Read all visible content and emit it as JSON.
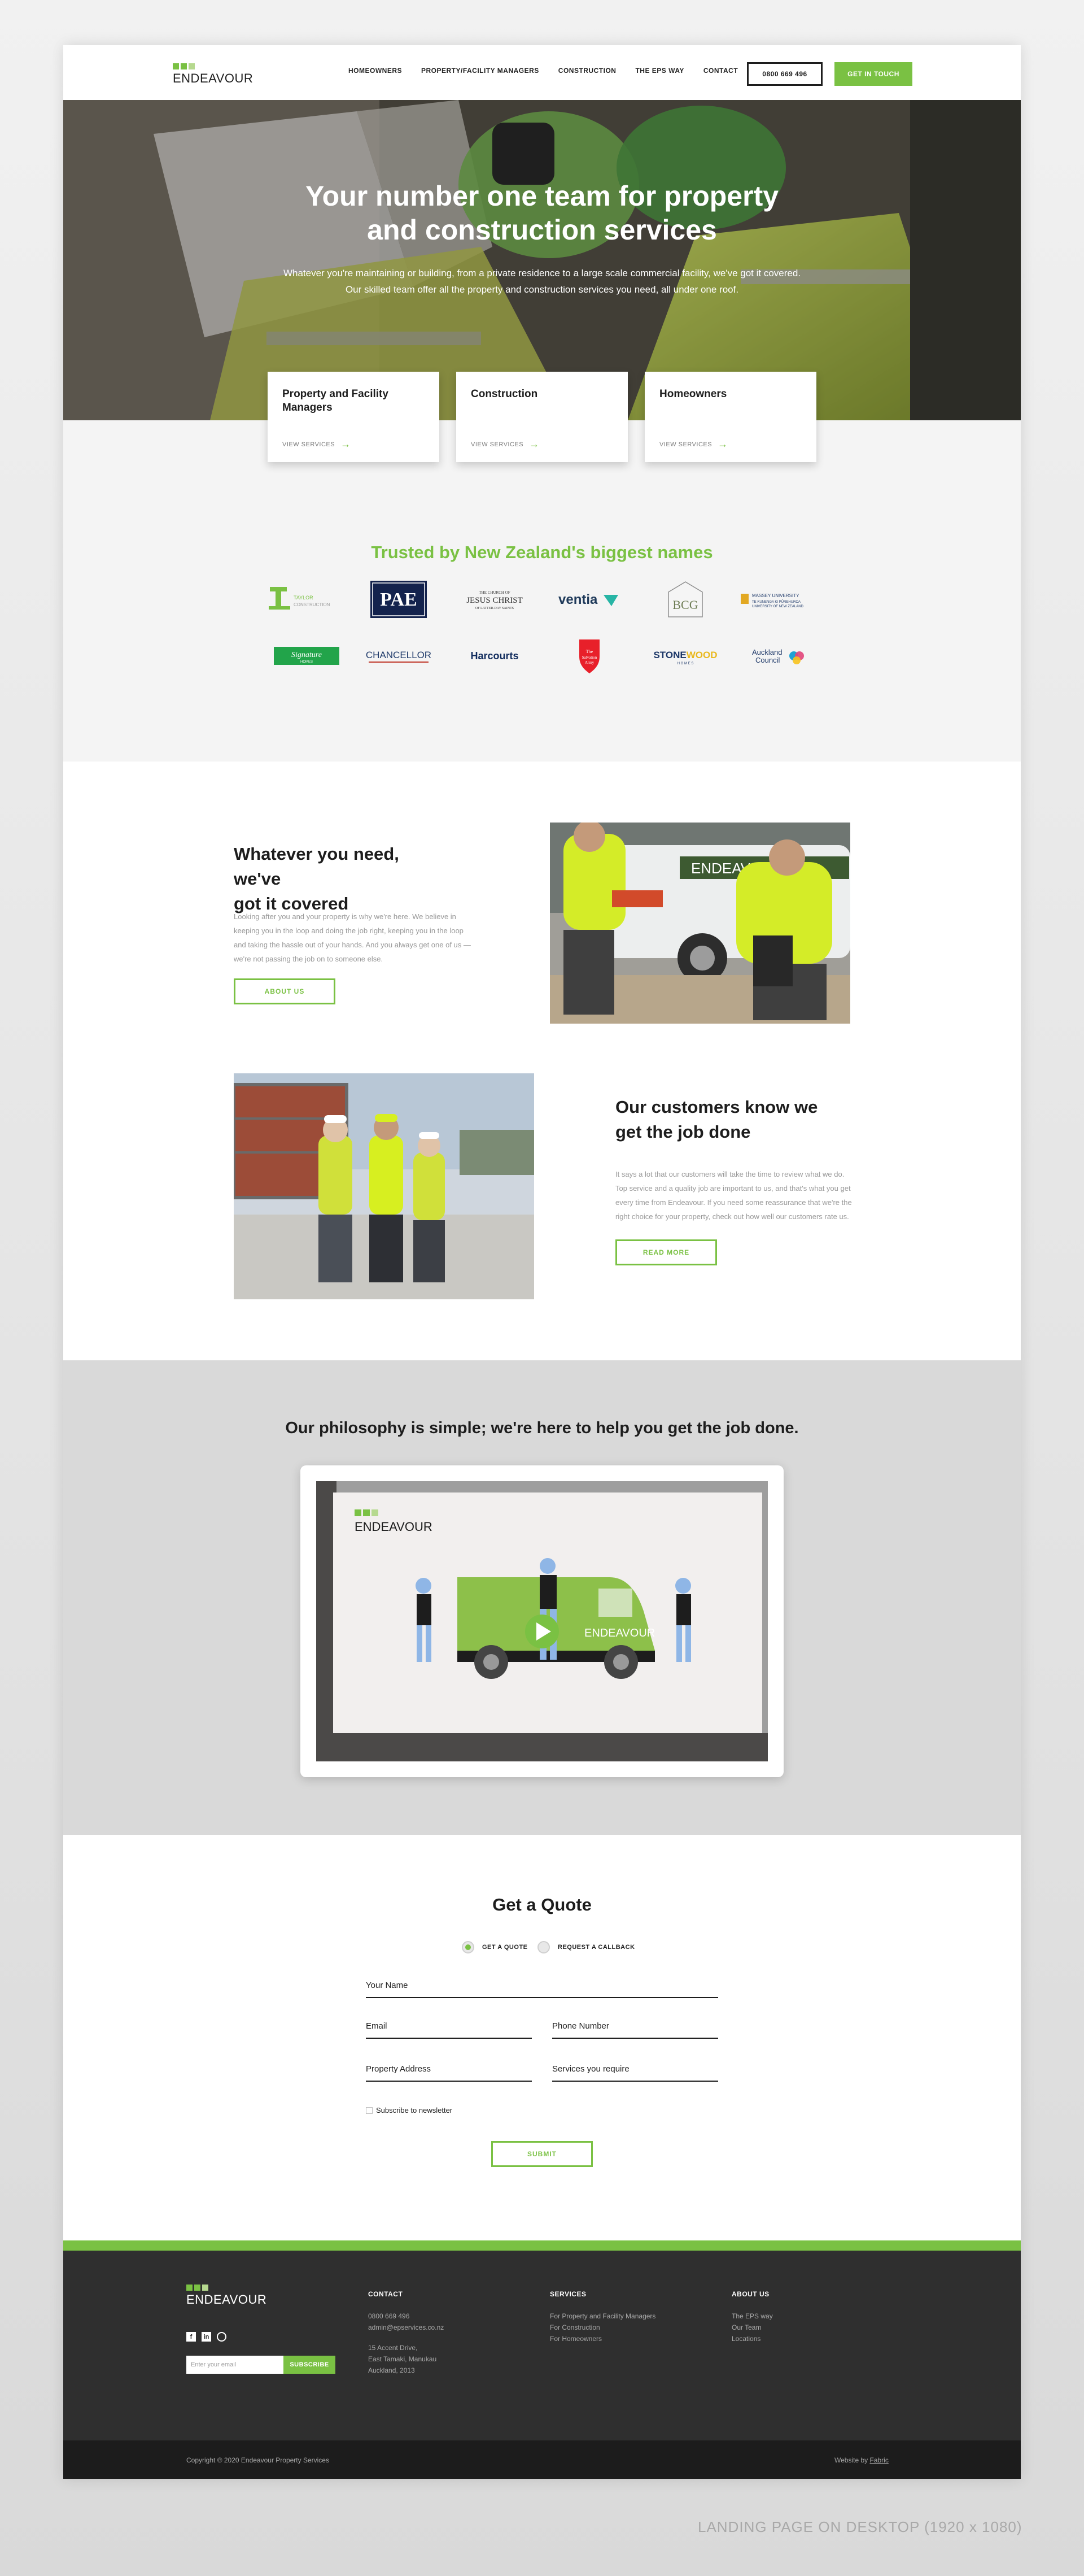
{
  "brand": {
    "name": "ENDEAVOUR",
    "green": "#7ac143",
    "light_green": "#b6d98f",
    "dark": "#1d1d1d"
  },
  "nav": {
    "items": [
      {
        "label": "HOMEOWNERS"
      },
      {
        "label": "PROPERTY/FACILITY MANAGERS"
      },
      {
        "label": "CONSTRUCTION"
      },
      {
        "label": "THE EPS WAY"
      },
      {
        "label": "CONTACT"
      }
    ],
    "phone": "0800 669 496",
    "cta": "GET IN TOUCH"
  },
  "hero": {
    "title_line1": "Your number one team for property",
    "title_line2": "and construction services",
    "subtitle": "Whatever you're maintaining or building, from a private residence to a large scale commercial facility, we've got it covered. Our skilled team offer all the property and construction services you need, all under one roof."
  },
  "service_cards": [
    {
      "title": "Property and Facility Managers",
      "link": "VIEW SERVICES"
    },
    {
      "title": "Construction",
      "link": "VIEW SERVICES"
    },
    {
      "title": "Homeowners",
      "link": "VIEW SERVICES"
    }
  ],
  "trusted": {
    "title": "Trusted by New Zealand's biggest names",
    "logos": [
      {
        "name": "TAYLOR CONSTRUCTION"
      },
      {
        "name": "PAE"
      },
      {
        "name": "JESUS CHRIST",
        "top": "THE CHURCH OF",
        "bottom": "OF LATTER-DAY SAINTS"
      },
      {
        "name": "ventia"
      },
      {
        "name": "BCG"
      },
      {
        "name": "MASSEY UNIVERSITY"
      },
      {
        "name": "Signature",
        "sub": "HOMES"
      },
      {
        "name": "CHANCELLOR"
      },
      {
        "name": "Harcourts"
      },
      {
        "name": "The Salvation Army"
      },
      {
        "name": "STONEWOOD",
        "sub": "HOMES"
      },
      {
        "name": "Auckland Council"
      }
    ]
  },
  "section_need": {
    "title_line1": "Whatever you need, we've",
    "title_line2": "got it covered",
    "body": "Looking after you and your property is why we're here. We believe in keeping you in the loop and doing the job right, keeping you in the loop and taking the hassle out of your hands. And you always get one of us — we're not passing the job on to someone else.",
    "button": "ABOUT US"
  },
  "section_customers": {
    "title_line1": "Our customers know we",
    "title_line2": "get the job done",
    "body": "It says a lot that our customers will take the time to review what we do. Top service and a quality job are important to us, and that's what you get every time from Endeavour. If you need some reassurance that we're the right choice for your property, check out how well our customers rate us.",
    "button": "READ MORE"
  },
  "philosophy": {
    "title": "Our philosophy is simple; we're here to help you get the job done.",
    "video_brand": "ENDEAVOUR",
    "van_text": "ENDEAVOUR"
  },
  "quote": {
    "title": "Get a Quote",
    "option_quote": "GET A QUOTE",
    "option_callback": "REQUEST A CALLBACK",
    "fields": {
      "name": "Your Name",
      "email": "Email",
      "phone": "Phone Number",
      "address": "Property Address",
      "services": "Services you require"
    },
    "newsletter": "Subscribe to newsletter",
    "submit": "SUBMIT"
  },
  "footer": {
    "subscribe_placeholder": "Enter your email",
    "subscribe_button": "SUBSCRIBE",
    "contact": {
      "heading": "CONTACT",
      "phone": "0800 669 496",
      "email": "admin@epservices.co.nz",
      "address_line1": "15 Accent Drive,",
      "address_line2": "East Tamaki, Manukau",
      "address_line3": "Auckland, 2013"
    },
    "services": {
      "heading": "SERVICES",
      "items": [
        "For Property and Facility Managers",
        "For Construction",
        "For Homeowners"
      ]
    },
    "about": {
      "heading": "ABOUT US",
      "items": [
        "The EPS way",
        "Our Team",
        "Locations"
      ]
    },
    "copyright": "Copyright © 2020 Endeavour Property Services",
    "website_by": "Website by",
    "agency": "Fabric"
  },
  "caption": "LANDING PAGE ON DESKTOP  (1920 x 1080)"
}
